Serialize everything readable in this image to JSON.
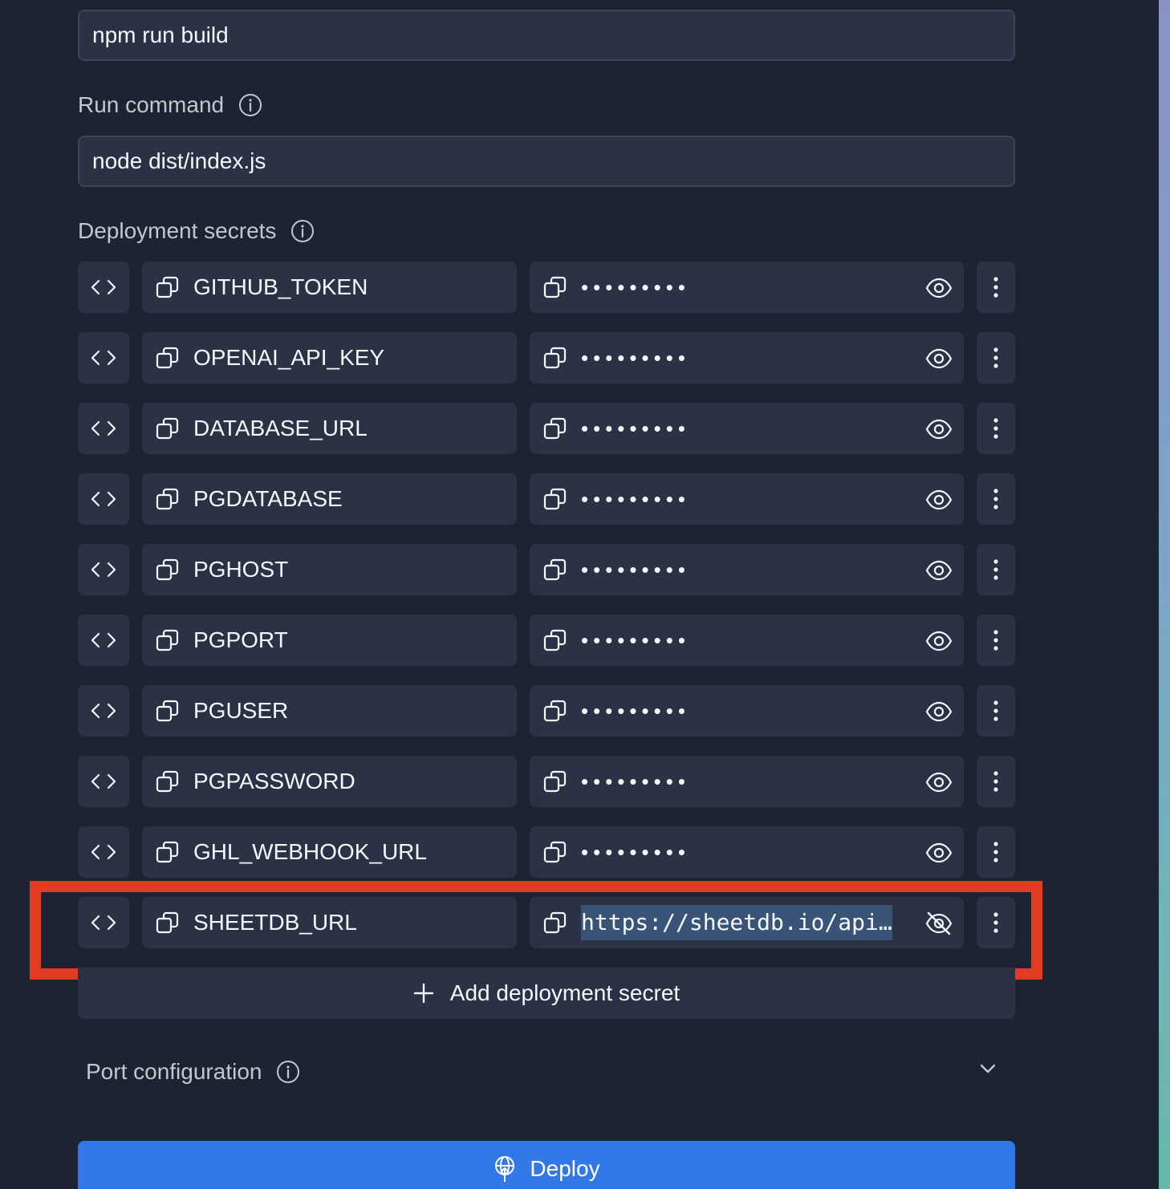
{
  "build_command": {
    "value": "npm run build"
  },
  "run_command": {
    "label": "Run command",
    "value": "node dist/index.js"
  },
  "deployment_secrets": {
    "label": "Deployment secrets",
    "items": [
      {
        "key": "GITHUB_TOKEN",
        "value": "•••••••••",
        "revealed": false
      },
      {
        "key": "OPENAI_API_KEY",
        "value": "•••••••••",
        "revealed": false
      },
      {
        "key": "DATABASE_URL",
        "value": "•••••••••",
        "revealed": false
      },
      {
        "key": "PGDATABASE",
        "value": "•••••••••",
        "revealed": false
      },
      {
        "key": "PGHOST",
        "value": "•••••••••",
        "revealed": false
      },
      {
        "key": "PGPORT",
        "value": "•••••••••",
        "revealed": false
      },
      {
        "key": "PGUSER",
        "value": "•••••••••",
        "revealed": false
      },
      {
        "key": "PGPASSWORD",
        "value": "•••••••••",
        "revealed": false
      },
      {
        "key": "GHL_WEBHOOK_URL",
        "value": "•••••••••",
        "revealed": false
      },
      {
        "key": "SHEETDB_URL",
        "value": "https://sheetdb.io/api/…",
        "revealed": true
      }
    ],
    "add_label": "Add deployment secret"
  },
  "port_configuration": {
    "label": "Port configuration"
  },
  "deploy_button": {
    "label": "Deploy"
  },
  "icons": {
    "info": "info-circle-icon",
    "code": "code-brackets-icon",
    "copy": "copy-icon",
    "eye": "eye-icon",
    "eye_off": "eye-off-icon",
    "menu": "vertical-dots-icon",
    "plus": "plus-icon",
    "chevron": "chevron-down-icon",
    "deploy": "deploy-globe-icon"
  },
  "colors": {
    "background": "#1c2333",
    "surface": "#2b3245",
    "highlight": "#e33b22",
    "primary": "#3278e6",
    "selection": "#3a5478"
  }
}
